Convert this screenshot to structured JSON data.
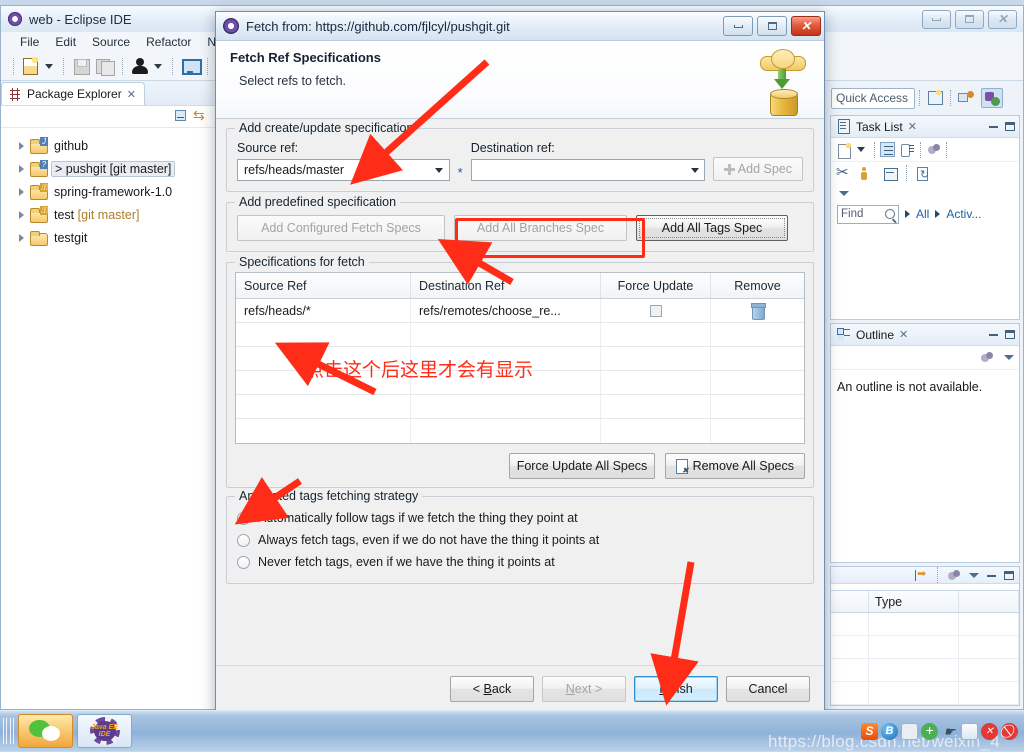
{
  "eclipse": {
    "title": "web - Eclipse IDE",
    "window_icon": "eclipse-icon",
    "menus": [
      "File",
      "Edit",
      "Source",
      "Refactor",
      "N"
    ],
    "toolbar_icons": [
      "new-file-icon",
      "dropdown-caret-icon",
      "save-icon",
      "save-all-icon",
      "person-icon",
      "dropdown-caret-icon",
      "monitor-icon",
      "pen-strike-icon"
    ],
    "window_buttons": [
      "minimize",
      "maximize",
      "close"
    ],
    "package_explorer": {
      "tab_label": "Package Explorer",
      "tab_close": "✕",
      "toolbar_icons": [
        "collapse-all-icon",
        "link-with-editor-icon"
      ],
      "tree": [
        {
          "label": "github",
          "meta": "",
          "badge": "J",
          "selected": false
        },
        {
          "label": "> pushgit",
          "meta": "[git master]",
          "badge": "?",
          "selected": true
        },
        {
          "label": "spring-framework-1.0",
          "meta": "",
          "badge": "L",
          "selected": false
        },
        {
          "label": "test",
          "meta": "[git master]",
          "badge": "L",
          "selected": false
        },
        {
          "label": "testgit",
          "meta": "",
          "badge": "",
          "selected": false
        }
      ]
    },
    "quick_access": {
      "placeholder": "Quick Access"
    },
    "perspective_icons": [
      "open-perspective-icon",
      "java-perspective-icon",
      "javaee-perspective-icon"
    ],
    "task_list": {
      "title": "Task List",
      "tab_close": "✕",
      "toolbar_icons": [
        "new-task-icon",
        "dropdown-caret-icon",
        "categorized-view-icon",
        "scheduled-view-icon",
        "focus-icon"
      ],
      "toolbar2_icons": [
        "scissors-icon",
        "people-icon",
        "collapse-icon",
        "synchronize-icon"
      ],
      "menu_icon": "view-menu-icon",
      "find_placeholder": "Find",
      "search_icon": "magnifier-icon",
      "filter_all": "All",
      "filter_activate": "Activ..."
    },
    "outline": {
      "title": "Outline",
      "tab_close": "✕",
      "toolbar_icons": [
        "focus-icon",
        "view-menu-icon"
      ],
      "message": "An outline is not available."
    },
    "properties_panel": {
      "toolbar_icons": [
        "indent-icon",
        "focus-icon",
        "view-menu-icon"
      ],
      "columns": [
        "",
        "Type",
        ""
      ],
      "rows": [
        [
          "",
          "",
          ""
        ],
        [
          "",
          "",
          ""
        ],
        [
          "",
          "",
          ""
        ],
        [
          "",
          "",
          ""
        ]
      ]
    }
  },
  "dialog": {
    "title": "Fetch from: https://github.com/fjlcyl/pushgit.git",
    "title_icon": "eclipse-icon",
    "window_buttons": [
      "minimize",
      "restore",
      "close"
    ],
    "banner": {
      "heading": "Fetch Ref Specifications",
      "subtext": "Select refs to fetch.",
      "art": "cloud-to-database-icon"
    },
    "create_update_group": {
      "title": "Add create/update specification",
      "source_label": "Source ref:",
      "source_value": "refs/heads/master",
      "destination_label": "Destination ref:",
      "destination_value": "",
      "required_marker": "*",
      "add_spec_label": "Add Spec",
      "add_spec_icon": "plus-icon"
    },
    "predefined_group": {
      "title": "Add predefined specification",
      "buttons": [
        {
          "label": "Add Configured Fetch Specs",
          "state": "disabled"
        },
        {
          "label": "Add All Branches Spec",
          "state": "disabled"
        },
        {
          "label": "Add All Tags Spec",
          "state": "focused"
        }
      ]
    },
    "specs_group": {
      "title": "Specifications for fetch",
      "columns": [
        "Source Ref",
        "Destination Ref",
        "Force Update",
        "Remove"
      ],
      "rows": [
        {
          "source": "refs/heads/*",
          "destination": "refs/remotes/choose_re...",
          "force_update": false,
          "remove_icon": "trash-icon"
        }
      ],
      "empty_rows": 5,
      "force_update_all_label": "Force Update All Specs",
      "remove_all_label": "Remove All Specs",
      "remove_all_icon": "document-delete-icon"
    },
    "tags_group": {
      "title": "Annotated tags fetching strategy",
      "options": [
        {
          "label": "Automatically follow tags if we fetch the thing they point at",
          "selected": true
        },
        {
          "label": "Always fetch tags, even if we do not have the thing it points at",
          "selected": false
        },
        {
          "label": "Never fetch tags, even if we have the thing it points at",
          "selected": false
        }
      ]
    },
    "footer_buttons": [
      {
        "label": "< Back",
        "state": "normal"
      },
      {
        "label": "Next >",
        "state": "disabled"
      },
      {
        "label": "Finish",
        "state": "default"
      },
      {
        "label": "Cancel",
        "state": "normal"
      }
    ]
  },
  "annotations": {
    "note_text": "点击这个后这里才会有显示",
    "color": "#ff2d18",
    "highlight_target": "Add All Branches Spec",
    "arrow_count": 4
  },
  "taskbar": {
    "buttons": [
      {
        "name": "wechat",
        "icon": "wechat-icon",
        "active": true
      },
      {
        "name": "eclipse-javaee",
        "icon": "javaee-ide-icon",
        "label_top": "Java EE",
        "label_bottom": "IDE",
        "active": false
      }
    ],
    "tray_icons": [
      "sogou-icon",
      "baidu-icon",
      "window-icon",
      "plus-icon",
      "hand-icon",
      "flag-icon",
      "error-icon",
      "mute-icon"
    ],
    "watermark": "https://blog.csdn.net/weixin_4"
  }
}
